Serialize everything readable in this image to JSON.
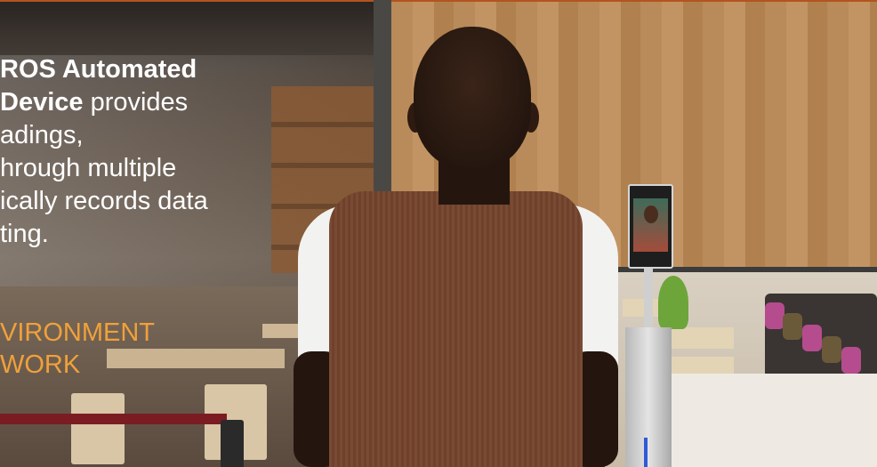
{
  "overlay": {
    "headline_lines": [
      {
        "bold": "ROS Automated",
        "normal": ""
      },
      {
        "bold": "Device",
        "normal": " provides"
      },
      {
        "bold": "",
        "normal": "adings,"
      },
      {
        "bold": "",
        "normal": "hrough multiple"
      },
      {
        "bold": "",
        "normal": "ically records data"
      },
      {
        "bold": "",
        "normal": "ting."
      }
    ],
    "tagline_lines": [
      "VIRONMENT",
      "WORK"
    ]
  },
  "colors": {
    "accent_orange": "#f0a13a",
    "top_border": "#b3541e",
    "headline_text": "#ffffff"
  }
}
